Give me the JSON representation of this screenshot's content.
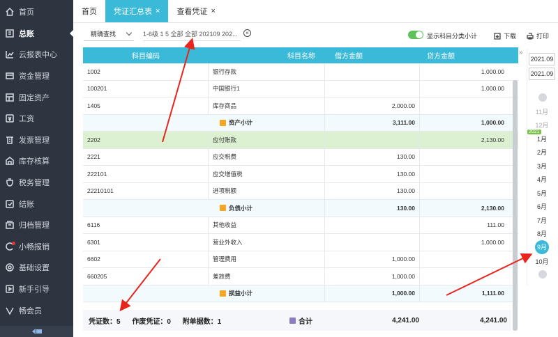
{
  "sidebar": {
    "items": [
      {
        "label": "首页",
        "icon": "home-icon"
      },
      {
        "label": "总账",
        "icon": "ledger-icon",
        "active": true
      },
      {
        "label": "云报表中心",
        "icon": "chart-icon"
      },
      {
        "label": "资金管理",
        "icon": "fund-icon"
      },
      {
        "label": "固定资产",
        "icon": "asset-icon"
      },
      {
        "label": "工资",
        "icon": "salary-icon"
      },
      {
        "label": "发票管理",
        "icon": "invoice-icon"
      },
      {
        "label": "库存核算",
        "icon": "warehouse-icon"
      },
      {
        "label": "税务管理",
        "icon": "tax-icon"
      },
      {
        "label": "结账",
        "icon": "close-account-icon"
      },
      {
        "label": "归档管理",
        "icon": "archive-icon"
      },
      {
        "label": "小畅报销",
        "icon": "reimburse-icon"
      },
      {
        "label": "基础设置",
        "icon": "settings-icon"
      },
      {
        "label": "新手引导",
        "icon": "guide-icon"
      },
      {
        "label": "畅会员",
        "icon": "vip-icon"
      }
    ]
  },
  "tabs": [
    {
      "label": "首页",
      "closable": false,
      "active": false
    },
    {
      "label": "凭证汇总表",
      "closable": true,
      "active": true
    },
    {
      "label": "查看凭证",
      "closable": true,
      "active": false
    }
  ],
  "toolbar": {
    "mode": "精确查找",
    "filter_text": "1-6级 1 5 全部 全部 202109 202...",
    "toggle_label": "显示科目分类小计",
    "download_label": "下载",
    "print_label": "打印"
  },
  "table": {
    "headers": [
      "科目编码",
      "科目名称",
      "借方金额",
      "贷方金额"
    ],
    "rows": [
      {
        "code": "1002",
        "name": "银行存款",
        "debit": "",
        "credit": "1,000.00"
      },
      {
        "code": "100201",
        "name": "中国银行1",
        "debit": "",
        "credit": "1,000.00"
      },
      {
        "code": "1405",
        "name": "库存商品",
        "debit": "2,000.00",
        "credit": ""
      },
      {
        "subtotal": true,
        "name": "资产小计",
        "debit": "3,111.00",
        "credit": "1,000.00"
      },
      {
        "code": "2202",
        "name": "应付账款",
        "debit": "",
        "credit": "2,130.00",
        "highlight": true
      },
      {
        "code": "2221",
        "name": "应交税费",
        "debit": "130.00",
        "credit": ""
      },
      {
        "code": "222101",
        "name": "应交增值税",
        "debit": "130.00",
        "credit": ""
      },
      {
        "code": "22210101",
        "name": "进项税额",
        "debit": "130.00",
        "credit": ""
      },
      {
        "subtotal": true,
        "name": "负债小计",
        "debit": "130.00",
        "credit": "2,130.00"
      },
      {
        "code": "6116",
        "name": "其他收益",
        "debit": "",
        "credit": "111.00"
      },
      {
        "code": "6301",
        "name": "营业外收入",
        "debit": "",
        "credit": "1,000.00"
      },
      {
        "code": "6602",
        "name": "管理费用",
        "debit": "1,000.00",
        "credit": ""
      },
      {
        "code": "660205",
        "name": "差旅费",
        "debit": "1,000.00",
        "credit": ""
      },
      {
        "subtotal": true,
        "name": "损益小计",
        "debit": "1,000.00",
        "credit": "1,111.00"
      }
    ],
    "footer": {
      "voucher_count": "凭证数：5",
      "void_count": "作废凭证：0",
      "attachment_count": "附单据数：1",
      "total_label": "合计",
      "total_debit": "4,241.00",
      "total_credit": "4,241.00"
    }
  },
  "date_panel": {
    "start": "2021.09",
    "end": "2021.09",
    "year_badge": "2021",
    "months": [
      "11月",
      "12月",
      "1月",
      "2月",
      "3月",
      "4月",
      "5月",
      "6月",
      "7月",
      "8月",
      "9月",
      "10月"
    ],
    "selected": "9月"
  },
  "colors": {
    "accent": "#3bb9d8",
    "sidebar_bg": "#2e3440",
    "highlight_row": "#dcf0d2",
    "toggle_on": "#5ec25b",
    "annotation_arrow": "#e8251d"
  }
}
